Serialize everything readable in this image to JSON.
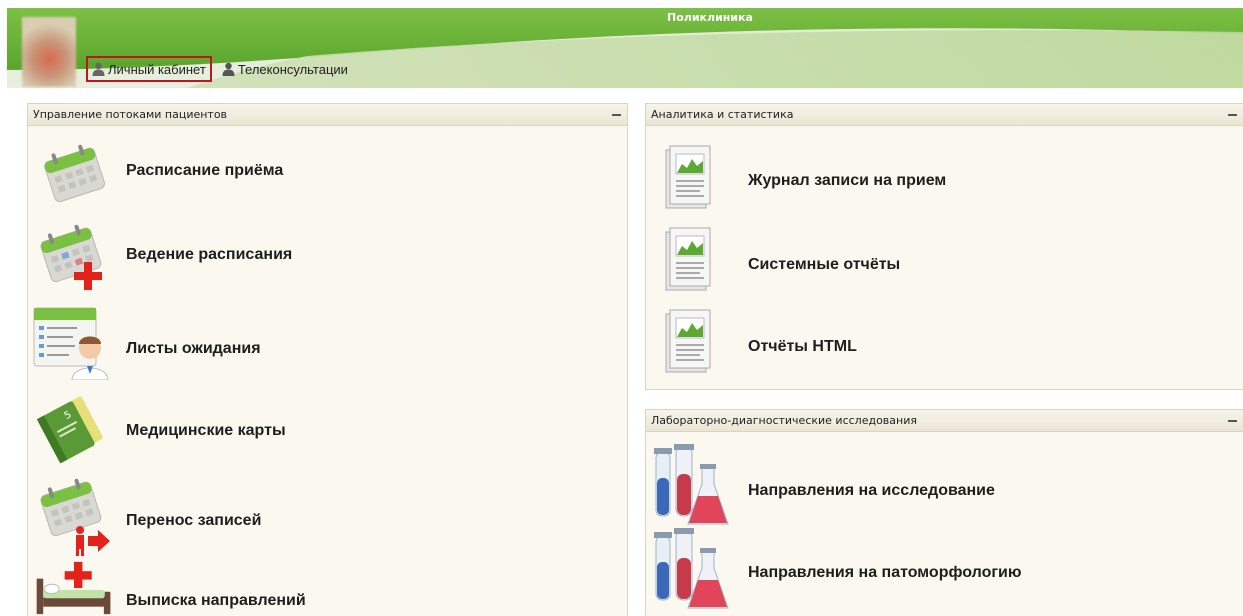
{
  "header": {
    "app_title": "Поликлиника",
    "nav": [
      {
        "label": "Личный кабинет"
      },
      {
        "label": "Телеконсультации"
      }
    ]
  },
  "patient_flow": {
    "title": "Управление потоками пациентов",
    "items": [
      {
        "label": "Расписание приёма",
        "icon": "calendar-icon"
      },
      {
        "label": "Ведение расписания",
        "icon": "calendar-add-icon"
      },
      {
        "label": "Листы ожидания",
        "icon": "waiting-list-icon"
      },
      {
        "label": "Медицинские карты",
        "icon": "medical-card-icon"
      },
      {
        "label": "Перенос записей",
        "icon": "calendar-transfer-icon"
      },
      {
        "label": "Выписка направлений",
        "icon": "hospital-bed-icon"
      }
    ]
  },
  "analytics": {
    "title": "Аналитика и статистика",
    "items": [
      {
        "label": "Журнал записи на прием",
        "icon": "report-icon"
      },
      {
        "label": "Системные отчёты",
        "icon": "report-icon"
      },
      {
        "label": "Отчёты HTML",
        "icon": "report-icon"
      }
    ]
  },
  "lab": {
    "title": "Лабораторно-диагностические исследования",
    "items": [
      {
        "label": "Направления на исследование",
        "icon": "lab-flasks-icon"
      },
      {
        "label": "Направления на патоморфологию",
        "icon": "lab-flasks-icon"
      }
    ]
  },
  "colors": {
    "header_green": "#6db33f",
    "active_border": "#c0141e",
    "panel_bg": "#fbf8ef"
  }
}
